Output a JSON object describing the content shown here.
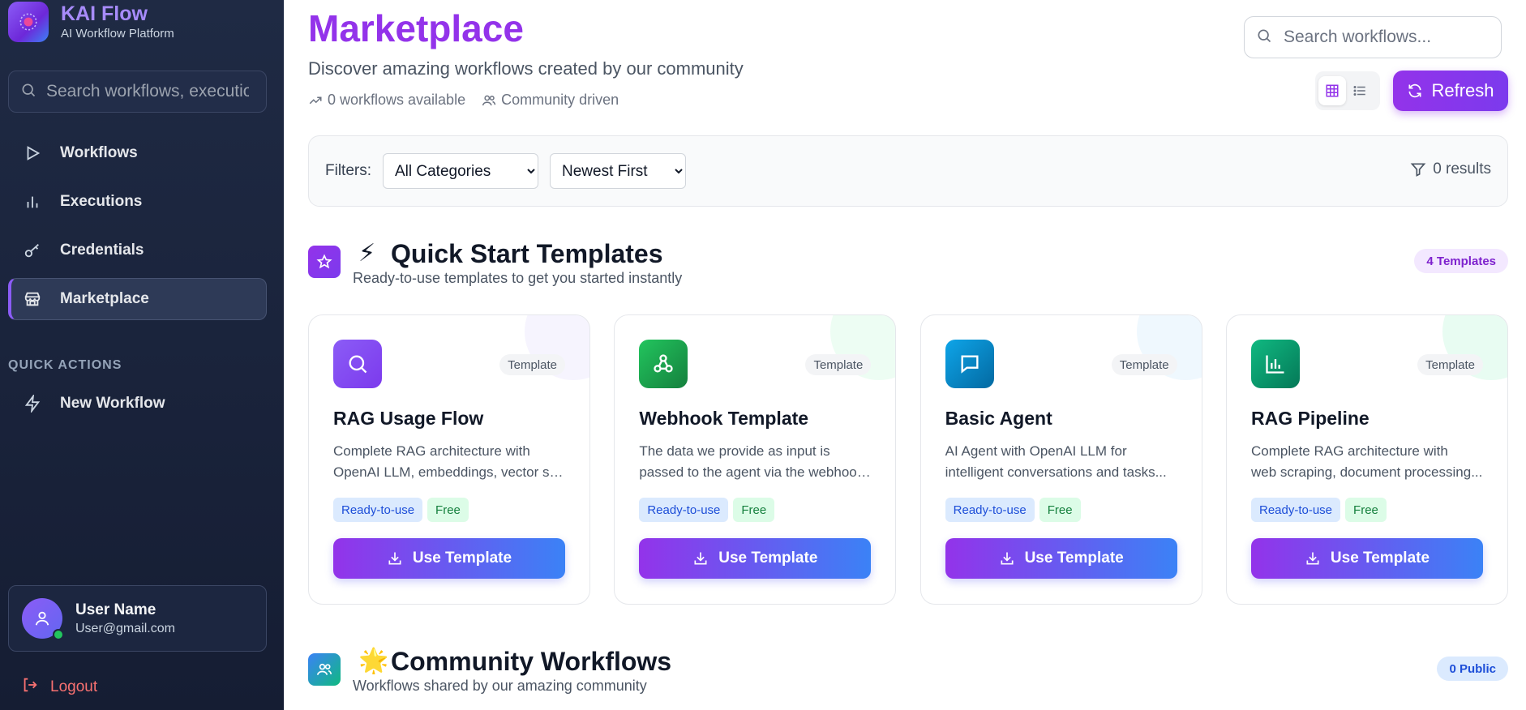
{
  "brand": {
    "title": "KAI Flow",
    "subtitle": "AI Workflow Platform"
  },
  "sidebar": {
    "search_placeholder": "Search workflows, executions...",
    "items": [
      {
        "label": "Workflows",
        "icon": "play-icon"
      },
      {
        "label": "Executions",
        "icon": "bar-chart-icon"
      },
      {
        "label": "Credentials",
        "icon": "key-icon"
      },
      {
        "label": "Marketplace",
        "icon": "store-icon",
        "active": true
      }
    ],
    "quick_actions_title": "QUICK ACTIONS",
    "quick_actions": [
      {
        "label": "New Workflow",
        "icon": "zap-icon"
      }
    ],
    "user": {
      "name": "User Name",
      "email": "User@gmail.com"
    },
    "logout_label": "Logout"
  },
  "header": {
    "title": "Marketplace",
    "subtitle": "Discover amazing workflows created by our community",
    "workflows_available": "0 workflows available",
    "community": "Community driven",
    "search_placeholder": "Search workflows...",
    "refresh_label": "Refresh"
  },
  "filters": {
    "label": "Filters:",
    "category_selected": "All Categories",
    "sort_selected": "Newest First",
    "results": "0 results"
  },
  "templates_section": {
    "emoji": "⚡",
    "title": "Quick Start Templates",
    "subtitle": "Ready-to-use templates to get you started instantly",
    "badge": "4 Templates"
  },
  "templates": [
    {
      "title": "RAG Usage Flow",
      "type": "Template",
      "desc1": "Complete RAG architecture with",
      "desc2": "OpenAI LLM, embeddings, vector store...",
      "tag1": "Ready-to-use",
      "tag2": "Free",
      "button": "Use Template",
      "icon": "search-icon",
      "color": "#8b5cf6"
    },
    {
      "title": "Webhook Template",
      "type": "Template",
      "desc1": "The data we provide as input is",
      "desc2": "passed to the agent via the webhook...",
      "tag1": "Ready-to-use",
      "tag2": "Free",
      "button": "Use Template",
      "icon": "webhook-icon",
      "color": "#16a34a"
    },
    {
      "title": "Basic Agent",
      "type": "Template",
      "desc1": "AI Agent with OpenAI LLM for",
      "desc2": "intelligent conversations and tasks...",
      "tag1": "Ready-to-use",
      "tag2": "Free",
      "button": "Use Template",
      "icon": "chat-icon",
      "color": "#0284c7"
    },
    {
      "title": "RAG Pipeline",
      "type": "Template",
      "desc1": "Complete RAG architecture with",
      "desc2": "web scraping, document processing...",
      "tag1": "Ready-to-use",
      "tag2": "Free",
      "button": "Use Template",
      "icon": "chart-icon",
      "color": "#059669"
    }
  ],
  "community_section": {
    "emoji": "🌟",
    "title": "Community Workflows",
    "subtitle": "Workflows shared by our amazing community",
    "badge": "0 Public"
  }
}
